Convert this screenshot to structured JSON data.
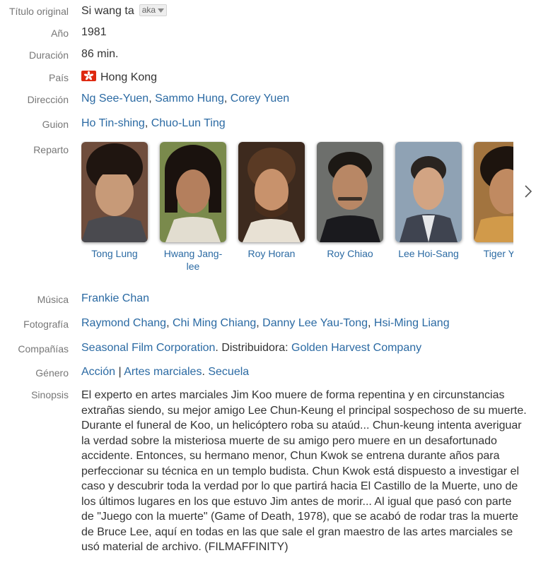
{
  "original_title": {
    "label": "Título original",
    "value": "Si wang ta",
    "aka": "aka"
  },
  "year": {
    "label": "Año",
    "value": "1981"
  },
  "duration": {
    "label": "Duración",
    "value": "86 min."
  },
  "country": {
    "label": "País",
    "value": "Hong Kong",
    "flag_icon": "hong-kong-flag-icon"
  },
  "direction": {
    "label": "Dirección",
    "people": [
      "Ng See-Yuen",
      "Sammo Hung",
      "Corey Yuen"
    ]
  },
  "screenplay": {
    "label": "Guion",
    "people": [
      "Ho Tin-shing",
      "Chuo-Lun Ting"
    ]
  },
  "cast": {
    "label": "Reparto",
    "members": [
      {
        "name": "Tong Lung"
      },
      {
        "name": "Hwang Jang-lee"
      },
      {
        "name": "Roy Horan"
      },
      {
        "name": "Roy Chiao"
      },
      {
        "name": "Lee Hoi-Sang"
      },
      {
        "name": "Tiger Yang"
      }
    ],
    "next_icon": "chevron-right-icon"
  },
  "music": {
    "label": "Música",
    "people": [
      "Frankie Chan"
    ]
  },
  "photography": {
    "label": "Fotografía",
    "people": [
      "Raymond Chang",
      "Chi Ming Chiang",
      "Danny Lee Yau-Tong",
      "Hsi-Ming Liang"
    ]
  },
  "companies": {
    "label": "Compañías",
    "producer": "Seasonal Film Corporation",
    "distributor_label": "Distribuidora:",
    "distributor": "Golden Harvest Company"
  },
  "genre": {
    "label": "Género",
    "items": [
      "Acción",
      "Artes marciales"
    ],
    "separator": " | ",
    "topic": "Secuela"
  },
  "synopsis": {
    "label": "Sinopsis",
    "text": "El experto en artes marciales Jim Koo muere de forma repentina y en circunstancias extrañas siendo, su mejor amigo Lee Chun-Keung el principal sospechoso de su muerte. Durante el funeral de Koo, un helicóptero roba su ataúd... Chun-keung intenta averiguar la verdad sobre la misteriosa muerte de su amigo pero muere en un desafortunado accidente. Entonces, su hermano menor, Chun Kwok se entrena durante años para perfeccionar su técnica en un templo budista. Chun Kwok está dispuesto a investigar el caso y descubrir toda la verdad por lo que partirá hacia El Castillo de la Muerte, uno de los últimos lugares en los que estuvo Jim antes de morir... Al igual que pasó con parte de \"Juego con la muerte\" (Game of Death, 1978), que se acabó de rodar tras la muerte de Bruce Lee, aquí en todas en las que sale el gran maestro de las artes marciales se usó material de archivo. (FILMAFFINITY)"
  }
}
